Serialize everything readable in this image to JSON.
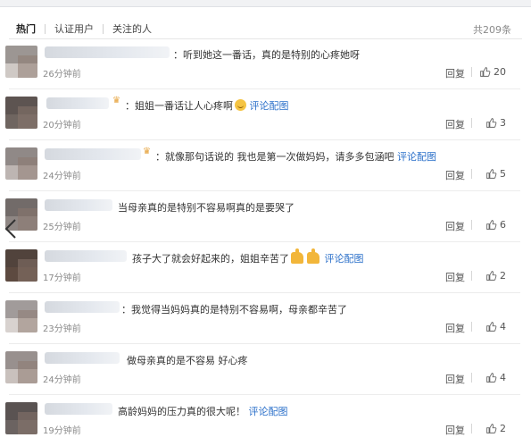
{
  "tabs": [
    "热门",
    "认证用户",
    "关注的人"
  ],
  "total": "共209条",
  "reply_label": "回复",
  "link_label": "评论配图",
  "icons": {
    "like": "thumbs-up-icon",
    "back": "chevron-left-icon"
  },
  "colors": {
    "link": "#2a6fc9",
    "text": "#333333",
    "muted": "#8a8a8a"
  },
  "comments": [
    {
      "prefix": "：",
      "text": "听到她这一番话，真的是特别的心疼她呀",
      "emoji": "",
      "link": "",
      "time": "26分钟前",
      "likes": "20"
    },
    {
      "prefix": "：",
      "text": "姐姐一番话让人心疼啊",
      "emoji": "crying-face",
      "link": "评论配图",
      "time": "20分钟前",
      "likes": "3"
    },
    {
      "prefix": "：",
      "text": "就像那句话说的 我也是第一次做妈妈，请多多包涵吧",
      "emoji": "",
      "link": "评论配图",
      "time": "24分钟前",
      "likes": "5"
    },
    {
      "prefix": "",
      "text": "当母亲真的是特别不容易啊真的是要哭了",
      "emoji": "",
      "link": "",
      "time": "25分钟前",
      "likes": "6"
    },
    {
      "prefix": "",
      "text": "孩子大了就会好起来的，姐姐辛苦了",
      "emoji": "thumbs-up x2",
      "link": "评论配图",
      "time": "17分钟前",
      "likes": "2"
    },
    {
      "prefix": "：",
      "text": "我觉得当妈妈真的是特别不容易啊，母亲都辛苦了",
      "emoji": "",
      "link": "",
      "time": "23分钟前",
      "likes": "4"
    },
    {
      "prefix": "",
      "text": "做母亲真的是不容易 好心疼",
      "emoji": "",
      "link": "",
      "time": "24分钟前",
      "likes": "4"
    },
    {
      "prefix": "",
      "text": "高龄妈妈的压力真的很大呢！",
      "emoji": "",
      "link": "评论配图",
      "time": "19分钟前",
      "likes": "2"
    }
  ]
}
